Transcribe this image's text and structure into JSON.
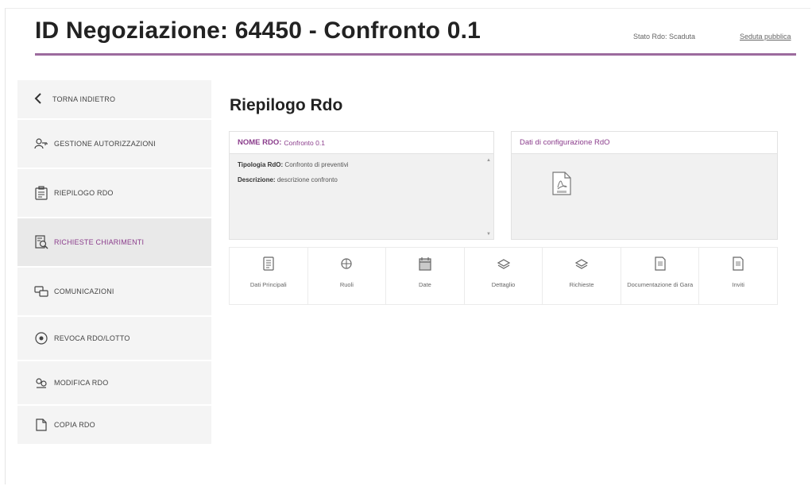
{
  "header": {
    "title": "ID Negoziazione: 64450 - Confronto 0.1",
    "stato": "Stato Rdo: Scaduta",
    "seduta": "Seduta pubblica"
  },
  "sidebar": {
    "back_label": "TORNA INDIETRO",
    "items": [
      {
        "label": "GESTIONE AUTORIZZAZIONI",
        "icon": "users-key-icon"
      },
      {
        "label": "RIEPILOGO RDO",
        "icon": "clipboard-icon"
      },
      {
        "label": "RICHIESTE CHIARIMENTI",
        "icon": "document-search-icon"
      },
      {
        "label": "COMUNICAZIONI",
        "icon": "chat-icon"
      },
      {
        "label": "REVOCA RDO/LOTTO",
        "icon": "revoke-icon"
      },
      {
        "label": "MODIFICA RDO",
        "icon": "edit-users-icon"
      },
      {
        "label": "COPIA RDO",
        "icon": "copy-document-icon"
      }
    ]
  },
  "main": {
    "title": "Riepilogo Rdo",
    "nome_rdo": {
      "label": "NOME RDO:",
      "value": "Confronto 0.1",
      "tipologia_label": "Tipologia RdO:",
      "tipologia_value": "Confronto di preventivi",
      "descrizione_label": "Descrizione:",
      "descrizione_value": "descrizione confronto"
    },
    "config": {
      "title": "Dati di configurazione RdO",
      "icon": "pdf-file-icon"
    },
    "tabs": [
      {
        "label": "Dati Principali",
        "icon": "document-list-icon"
      },
      {
        "label": "Ruoli",
        "icon": "roles-icon"
      },
      {
        "label": "Date",
        "icon": "calendar-icon"
      },
      {
        "label": "Dettaglio",
        "icon": "layers-icon"
      },
      {
        "label": "Richieste",
        "icon": "layers-icon"
      },
      {
        "label": "Documentazione di Gara",
        "icon": "file-icon"
      },
      {
        "label": "Inviti",
        "icon": "file-icon"
      }
    ]
  },
  "colors": {
    "accent": "#8b3d8c",
    "rule": "#9c6b9e",
    "sidebar_bg": "#f4f4f4"
  }
}
